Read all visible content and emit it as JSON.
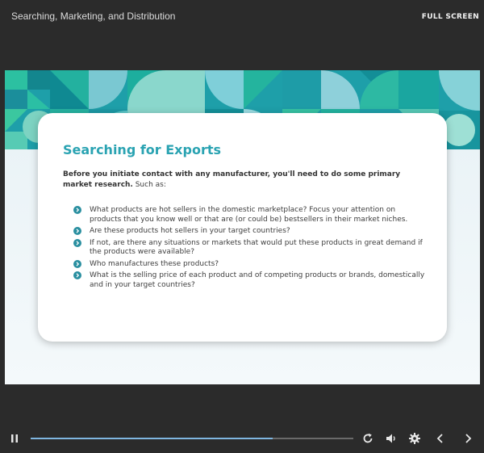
{
  "header": {
    "course_title": "Searching, Marketing, and Distribution",
    "fullscreen_label": "FULL SCREEN"
  },
  "slide": {
    "title": "Searching for Exports",
    "intro_bold": "Before you initiate contact with any manufacturer, you'll need to do some primary market research.",
    "intro_rest": " Such as:",
    "bullets": [
      "What products are hot sellers in the domestic marketplace? Focus your attention on products that you know well or that are (or could be) bestsellers in their market niches.",
      "Are these products hot sellers in your target countries?",
      "If not, are there any situations or markets that would put these products in great demand if the products were available?",
      "Who manufactures these products?",
      "What is the selling price of each product and of competing products or brands, domestically and in your target countries?"
    ]
  },
  "player": {
    "progress": 0.75,
    "icons": [
      "pause-icon",
      "replay-icon",
      "volume-icon",
      "settings-icon",
      "previous-icon",
      "next-icon"
    ]
  },
  "colors": {
    "background": "#2b2b2b",
    "accent": "#2aa3b2",
    "progress": "#7fb6e0",
    "bullet": "#2a8fa0"
  }
}
